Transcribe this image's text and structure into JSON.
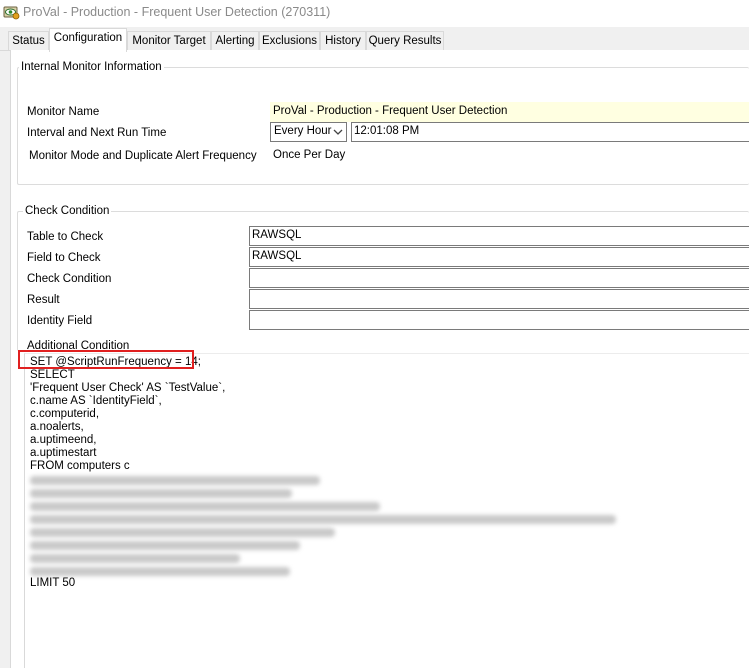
{
  "window": {
    "title": "ProVal - Production - Frequent User Detection (270311)",
    "icon": "monitor-app-icon"
  },
  "tabs": [
    {
      "label": "Status",
      "active": false
    },
    {
      "label": "Configuration",
      "active": true
    },
    {
      "label": "Monitor Target",
      "active": false
    },
    {
      "label": "Alerting",
      "active": false
    },
    {
      "label": "Exclusions",
      "active": false
    },
    {
      "label": "History",
      "active": false
    },
    {
      "label": "Query Results",
      "active": false
    }
  ],
  "internal_monitor": {
    "legend": "Internal Monitor Information",
    "monitor_name_label": "Monitor Name",
    "monitor_name_value": "ProVal - Production - Frequent User Detection",
    "interval_label": "Interval and Next Run Time",
    "interval_value": "Every Hour",
    "next_run_time": "12:01:08 PM",
    "mode_label": "Monitor Mode and Duplicate Alert Frequency",
    "mode_value": "Once Per Day"
  },
  "check_condition": {
    "legend": "Check Condition",
    "table_label": "Table to Check",
    "table_value": "RAWSQL",
    "field_label": "Field to Check",
    "field_value": "RAWSQL",
    "condition_label": "Check Condition",
    "condition_value": "",
    "result_label": "Result",
    "result_value": "",
    "identity_label": "Identity Field",
    "identity_value": "",
    "additional_label": "Additional Condition"
  },
  "sql": {
    "lines": [
      "SET @ScriptRunFrequency = 14;",
      "SELECT",
      "'Frequent User Check' AS `TestValue`,",
      "c.name AS `IdentityField`,",
      "c.computerid,",
      "a.noalerts,",
      "a.uptimeend,",
      "a.uptimestart",
      "FROM computers c"
    ],
    "last_line": "LIMIT 50"
  },
  "colors": {
    "highlight_box": "#e02020",
    "monitor_name_bg": "#ffffe1",
    "title_text": "#8a8a8a"
  }
}
